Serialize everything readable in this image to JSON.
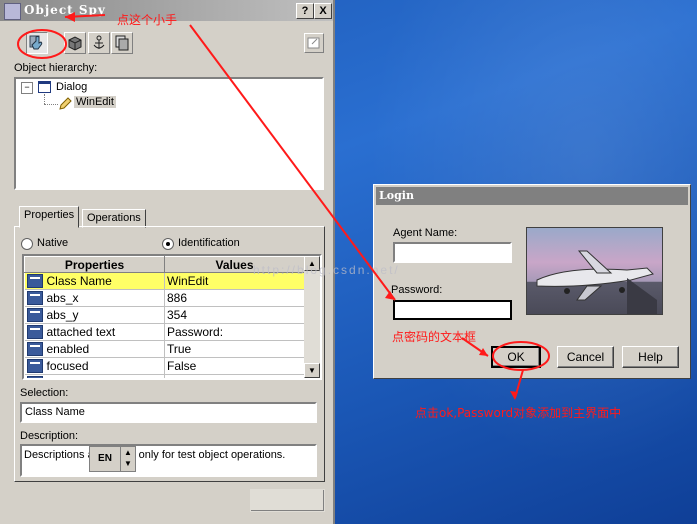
{
  "spy": {
    "title": "Object Spy",
    "help_btn": "?",
    "close_btn": "X",
    "hierarchy_label": "Object hierarchy:",
    "tree": [
      {
        "label": "Dialog",
        "expander": "⊟"
      },
      {
        "label": "WinEdit"
      }
    ],
    "tabs": [
      {
        "label": "Properties"
      },
      {
        "label": "Operations"
      }
    ],
    "radios": [
      {
        "label": "Native"
      },
      {
        "label": "Identification"
      }
    ],
    "table": {
      "headers": [
        "Properties",
        "Values"
      ],
      "rows": [
        {
          "prop": "Class Name",
          "value": "WinEdit"
        },
        {
          "prop": "abs_x",
          "value": "886"
        },
        {
          "prop": "abs_y",
          "value": "354"
        },
        {
          "prop": "attached text",
          "value": "Password:"
        },
        {
          "prop": "enabled",
          "value": "True"
        },
        {
          "prop": "focused",
          "value": "False"
        },
        {
          "prop": "...",
          "value": "..."
        }
      ]
    },
    "selection_label": "Selection:",
    "selection_value": "Class Name",
    "description_label": "Description:",
    "description_left": "Descriptions a",
    "description_right": "le only for test object operations.",
    "ime_label": "EN"
  },
  "login": {
    "title": "Login",
    "agent_label": "Agent Name:",
    "agent_value": "",
    "password_label": "Password:",
    "password_value": "",
    "ok": "OK",
    "cancel": "Cancel",
    "help": "Help"
  },
  "annotations": {
    "hand": "点这个小手",
    "password": "点密码的文本框",
    "ok": "点击ok,Password对象添加到主界面中"
  },
  "watermark": "http://blog.csdn.net/",
  "colors": {
    "annotation": "#ff1a1a",
    "desktop": "#2a6fd1",
    "selected_row": "#ffff66"
  }
}
